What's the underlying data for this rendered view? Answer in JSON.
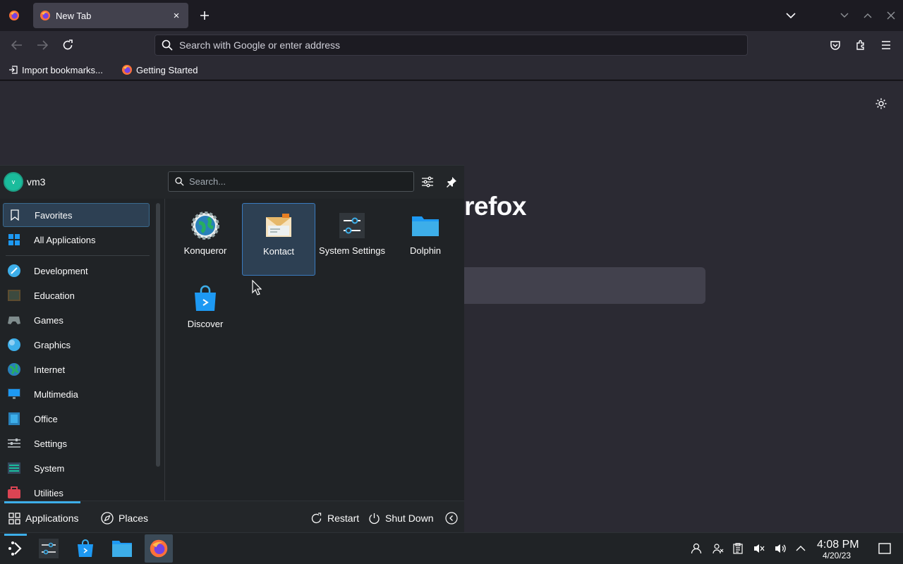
{
  "browser": {
    "tab": {
      "title": "New Tab",
      "close": "×"
    },
    "new_tab": "+",
    "urlbar": {
      "placeholder": "Search with Google or enter address"
    },
    "bookmarks": [
      {
        "label": "Import bookmarks..."
      },
      {
        "label": "Getting Started"
      }
    ],
    "content": {
      "brand_fragment": "refox"
    }
  },
  "launcher": {
    "user": {
      "initial": "v",
      "name": "vm3"
    },
    "search": {
      "placeholder": "Search..."
    },
    "categories": [
      {
        "label": "Favorites",
        "icon": "bookmark-icon",
        "selected": true
      },
      {
        "label": "All Applications",
        "icon": "grid-icon"
      },
      {
        "label": "Development",
        "icon": "development-icon"
      },
      {
        "label": "Education",
        "icon": "education-icon"
      },
      {
        "label": "Games",
        "icon": "gamepad-icon"
      },
      {
        "label": "Graphics",
        "icon": "graphics-icon"
      },
      {
        "label": "Internet",
        "icon": "globe-icon"
      },
      {
        "label": "Multimedia",
        "icon": "multimedia-icon"
      },
      {
        "label": "Office",
        "icon": "office-icon"
      },
      {
        "label": "Settings",
        "icon": "settings-icon"
      },
      {
        "label": "System",
        "icon": "system-icon"
      },
      {
        "label": "Utilities",
        "icon": "utilities-icon"
      }
    ],
    "apps": [
      {
        "label": "Konqueror",
        "icon": "konqueror-icon"
      },
      {
        "label": "Kontact",
        "icon": "kontact-icon",
        "selected": true
      },
      {
        "label": "System Settings",
        "icon": "system-settings-icon"
      },
      {
        "label": "Dolphin",
        "icon": "folder-icon"
      },
      {
        "label": "Discover",
        "icon": "discover-icon"
      }
    ],
    "footer": {
      "applications": "Applications",
      "places": "Places",
      "restart": "Restart",
      "shutdown": "Shut Down"
    }
  },
  "panel": {
    "clock": {
      "time": "4:08 PM",
      "date": "4/20/23"
    }
  },
  "colors": {
    "accent": "#3daee9",
    "selection": "#2d4053",
    "firefox_dark": "#2b2a33"
  }
}
